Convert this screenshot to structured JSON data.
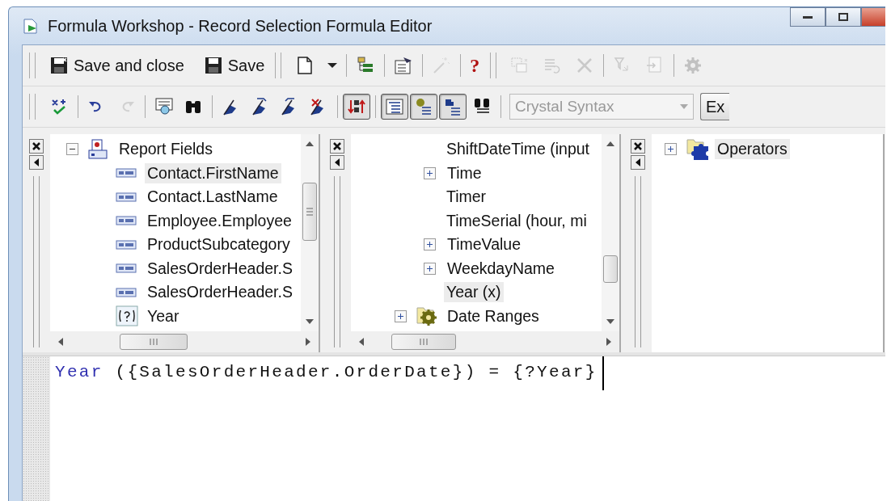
{
  "window": {
    "title": "Formula Workshop - Record Selection Formula Editor"
  },
  "toolbar_1": {
    "sections": [
      {
        "groups": [
          {
            "tools": [
              {
                "label": "Save and close",
                "disabled": false
              },
              {
                "label": "Save",
                "disabled": false
              }
            ]
          }
        ]
      },
      {
        "groups": [
          {
            "tools": [
              {
                "disabled": false
              },
              {
                "disabled": false
              }
            ]
          },
          {
            "tools": [
              {
                "disabled": false
              }
            ]
          },
          {
            "tools": [
              {
                "disabled": false
              }
            ]
          },
          {
            "tools": [
              {
                "disabled": true
              }
            ]
          },
          {
            "tools": [
              {
                "glyph": "?",
                "disabled": false
              }
            ]
          }
        ]
      },
      {
        "groups": [
          {
            "tools": [
              {
                "disabled": true
              },
              {
                "disabled": true
              },
              {
                "disabled": true
              }
            ]
          },
          {
            "tools": [
              {
                "disabled": true
              },
              {
                "disabled": true
              }
            ]
          },
          {
            "tools": [
              {
                "disabled": true
              }
            ]
          }
        ]
      }
    ]
  },
  "toolbar_2": {
    "groups": [
      {
        "tools": [
          {
            "pressed": false,
            "disabled": false
          }
        ]
      },
      {
        "tools": [
          {
            "pressed": false,
            "disabled": false
          },
          {
            "pressed": false,
            "disabled": true
          }
        ]
      },
      {
        "tools": [
          {
            "pressed": false,
            "disabled": false
          },
          {
            "pressed": false,
            "disabled": false
          }
        ]
      },
      {
        "tools": [
          {
            "pressed": false,
            "disabled": false
          },
          {
            "pressed": false,
            "disabled": false
          },
          {
            "pressed": false,
            "disabled": false
          },
          {
            "pressed": false,
            "disabled": false
          }
        ]
      },
      {
        "tools": [
          {
            "pressed": true,
            "disabled": false
          }
        ]
      },
      {
        "tools": [
          {
            "pressed": true,
            "disabled": false
          },
          {
            "pressed": true,
            "disabled": false
          },
          {
            "pressed": true,
            "disabled": false
          },
          {
            "pressed": false,
            "disabled": false
          }
        ]
      }
    ],
    "syntax_dropdown": {
      "value": "Crystal Syntax",
      "disabled": true
    },
    "button": {
      "label": "Ex"
    }
  },
  "panes": [
    {
      "nodes": [
        {
          "label": "Report Fields",
          "kind": "report",
          "expanded": true,
          "selected": false,
          "children": [
            {
              "label": "Contact.FirstName",
              "kind": "field",
              "selected": true
            },
            {
              "label": "Contact.LastName",
              "kind": "field",
              "selected": false
            },
            {
              "label": "Employee.Employee",
              "kind": "field",
              "selected": false
            },
            {
              "label": "ProductSubcategory",
              "kind": "field",
              "selected": false
            },
            {
              "label": "SalesOrderHeader.S",
              "kind": "field",
              "selected": false
            },
            {
              "label": "SalesOrderHeader.S",
              "kind": "field",
              "selected": false
            },
            {
              "label": "Year",
              "kind": "parameter",
              "selected": false
            }
          ]
        }
      ]
    },
    {
      "nodes": [
        {
          "children": [
            {
              "label": "ShiftDateTime (input",
              "kind": "function",
              "selected": false
            },
            {
              "label": "Time",
              "kind": "function",
              "expanded": false,
              "selected": false
            },
            {
              "label": "Timer",
              "kind": "function",
              "selected": false
            },
            {
              "label": "TimeSerial (hour, mi",
              "kind": "function",
              "selected": false
            },
            {
              "label": "TimeValue",
              "kind": "function",
              "expanded": false,
              "selected": false
            },
            {
              "label": "WeekdayName",
              "kind": "function",
              "expanded": false,
              "selected": false
            },
            {
              "label": "Year (x)",
              "kind": "function",
              "selected": true
            }
          ]
        },
        {
          "label": "Date Ranges",
          "kind": "gear-folder",
          "expanded": false,
          "selected": false
        }
      ]
    },
    {
      "nodes": [
        {
          "label": "Operators",
          "kind": "puzzle-folder",
          "expanded": false,
          "selected": true
        }
      ]
    }
  ],
  "editor": {
    "tokens": [
      {
        "text": "Year",
        "kind": "keyword"
      },
      {
        "text": " ({SalesOrderHeader.OrderDate}) = {?Year}",
        "kind": "plain"
      }
    ]
  }
}
